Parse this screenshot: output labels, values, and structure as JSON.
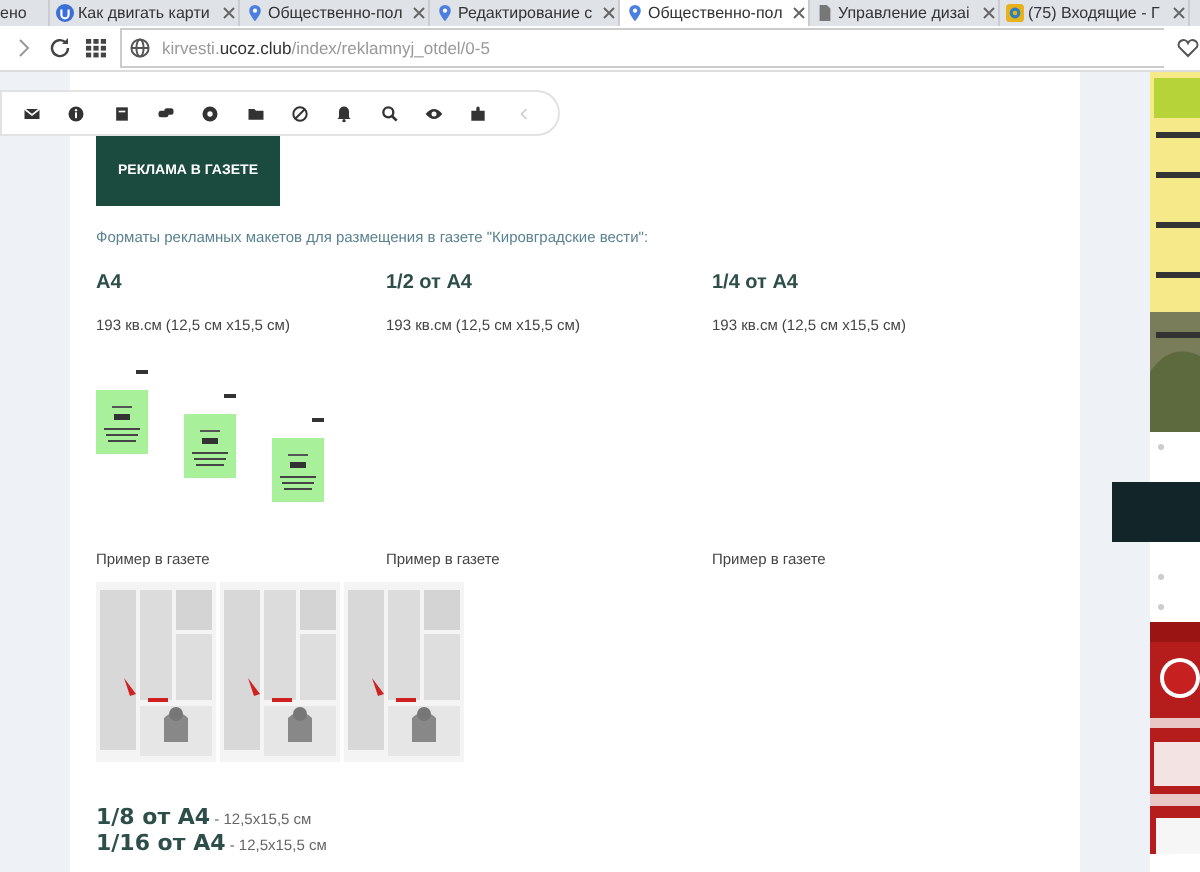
{
  "browser": {
    "tabs": [
      {
        "title": "ено",
        "selected": false
      },
      {
        "title": "Как двигать карти",
        "selected": false
      },
      {
        "title": "Общественно-пол",
        "selected": false
      },
      {
        "title": "Редактирование с",
        "selected": false
      },
      {
        "title": "Общественно-пол",
        "selected": true
      },
      {
        "title": "Управление дизаі",
        "selected": false
      },
      {
        "title": "(75) Входящие - Г",
        "selected": false
      }
    ],
    "address": {
      "host": "kirvesti.",
      "domain": "ucoz.club",
      "path": "/index/reklamnyj_otdel/0-5"
    }
  },
  "page": {
    "button": "РЕКЛАМА В ГАЗЕТЕ",
    "intro": "Форматы рекламных макетов для размещения в газете \"Кировградские вести\":",
    "formats": [
      {
        "title": "A4",
        "size": "193 кв.см (12,5 см х15,5 см)",
        "example": "Пример в газете"
      },
      {
        "title": "1/2 от A4",
        "size": "193 кв.см (12,5 см х15,5 см)",
        "example": "Пример в газете"
      },
      {
        "title": "1/4 от A4",
        "size": "193 кв.см (12,5 см х15,5 см)",
        "example": "Пример в газете"
      }
    ],
    "small_formats": [
      {
        "title": "1/8 от A4",
        "size": " - 12,5x15,5 см"
      },
      {
        "title": "1/16 от A4",
        "size": " - 12,5x15,5 см"
      }
    ]
  }
}
